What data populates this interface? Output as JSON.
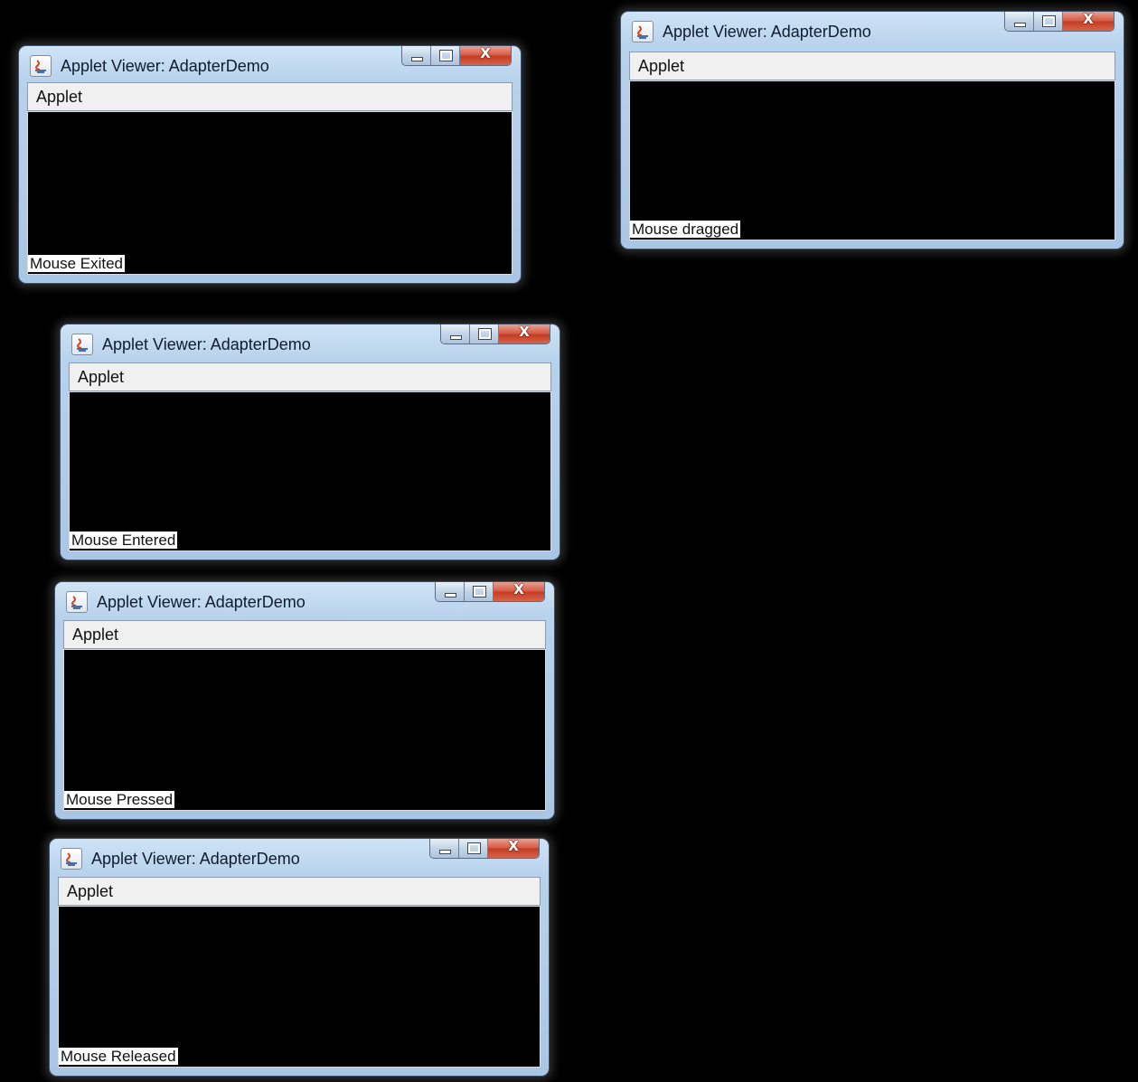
{
  "windows": [
    {
      "title": "Applet Viewer: AdapterDemo",
      "menu": "Applet",
      "status": "Mouse Exited",
      "close_glyph": "X",
      "icon": "java-icon"
    },
    {
      "title": "Applet Viewer: AdapterDemo",
      "menu": "Applet",
      "status": "Mouse dragged",
      "close_glyph": "X",
      "icon": "java-icon"
    },
    {
      "title": "Applet Viewer: AdapterDemo",
      "menu": "Applet",
      "status": "Mouse Entered",
      "close_glyph": "X",
      "icon": "java-icon"
    },
    {
      "title": "Applet Viewer: AdapterDemo",
      "menu": "Applet",
      "status": "Mouse Pressed",
      "close_glyph": "X",
      "icon": "java-icon"
    },
    {
      "title": "Applet Viewer: AdapterDemo",
      "menu": "Applet",
      "status": "Mouse Released",
      "close_glyph": "X",
      "icon": "java-icon"
    }
  ],
  "colors": {
    "background": "#000000",
    "titlebar": "#b7d2ec",
    "close_button": "#d65a43",
    "applet_area": "#000000"
  }
}
